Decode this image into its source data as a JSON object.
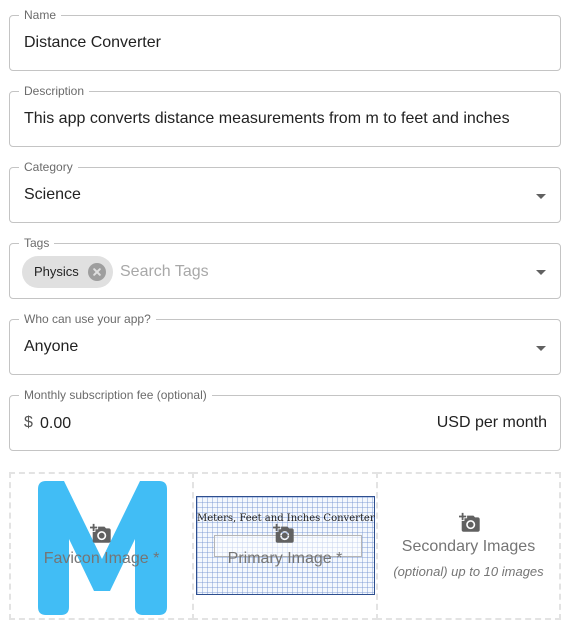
{
  "form": {
    "name": {
      "label": "Name",
      "value": "Distance Converter"
    },
    "description": {
      "label": "Description",
      "value": "This app converts distance measurements from m to feet and inches"
    },
    "category": {
      "label": "Category",
      "value": "Science"
    },
    "tags": {
      "label": "Tags",
      "chips": [
        "Physics"
      ],
      "placeholder": "Search Tags"
    },
    "audience": {
      "label": "Who can use your app?",
      "value": "Anyone"
    },
    "fee": {
      "label": "Monthly subscription fee (optional)",
      "prefix": "$",
      "value": "0.00",
      "suffix": "USD per month"
    }
  },
  "images": {
    "favicon": {
      "caption": "Favicon Image *",
      "logo_letter": "M",
      "logo_color": "#41bdf5"
    },
    "primary": {
      "caption": "Primary Image *",
      "screenshot_title": "Meters, Feet and Inches Converter"
    },
    "secondary": {
      "caption": "Secondary Images",
      "sub": "(optional) up to 10 images"
    }
  },
  "icons": {
    "upload": "add-photo-icon",
    "dropdown": "arrow-drop-down-icon",
    "chip_delete": "cancel-icon"
  },
  "colors": {
    "border": "#c4c4c4",
    "label": "#6b6b6b",
    "chip_bg": "#e0e0e0",
    "dashed": "#e3e3e3"
  }
}
